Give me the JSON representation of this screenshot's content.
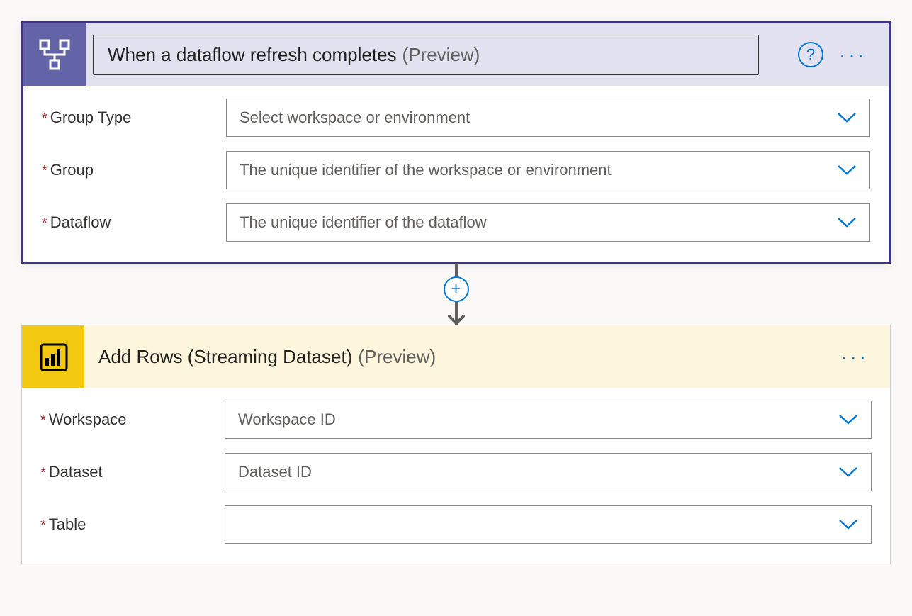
{
  "trigger": {
    "title": "When a dataflow refresh completes",
    "suffix": "(Preview)",
    "fields": [
      {
        "label": "Group Type",
        "placeholder": "Select workspace or environment",
        "required": true
      },
      {
        "label": "Group",
        "placeholder": "The unique identifier of the workspace or environment",
        "required": true
      },
      {
        "label": "Dataflow",
        "placeholder": "The unique identifier of the dataflow",
        "required": true
      }
    ]
  },
  "action": {
    "title": "Add Rows (Streaming Dataset)",
    "suffix": "(Preview)",
    "fields": [
      {
        "label": "Workspace",
        "placeholder": "Workspace ID",
        "required": true
      },
      {
        "label": "Dataset",
        "placeholder": "Dataset ID",
        "required": true
      },
      {
        "label": "Table",
        "placeholder": "",
        "required": true
      }
    ]
  },
  "icons": {
    "help": "?",
    "more": "···",
    "plus": "+"
  }
}
